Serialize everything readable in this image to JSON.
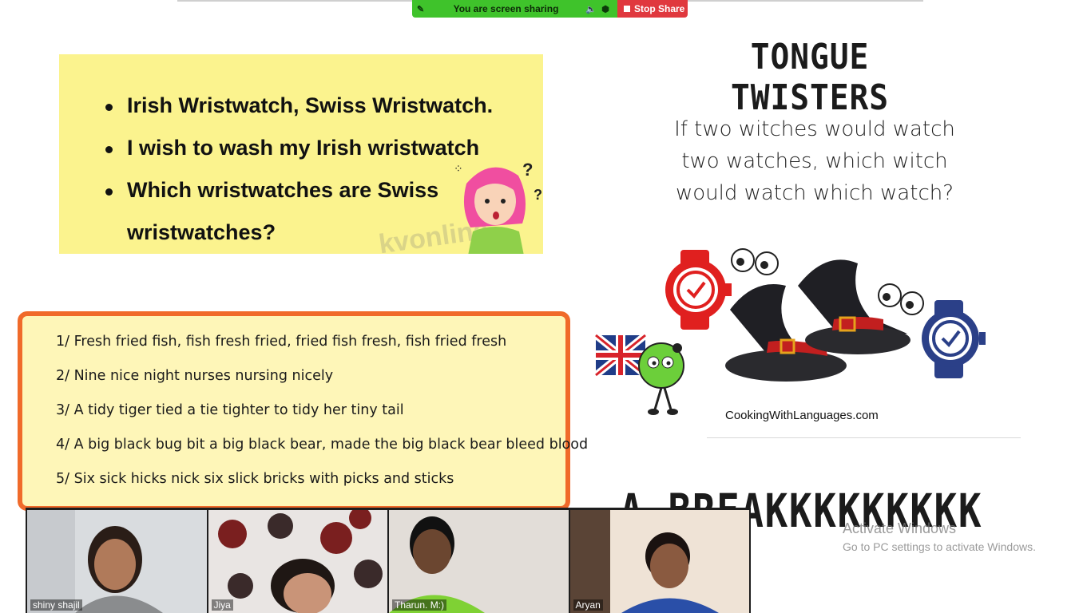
{
  "share_bar": {
    "message": "You are screen sharing",
    "stop_label": "Stop Share",
    "pin_icon": "pin-icon",
    "volume_icon": "speaker-icon",
    "shield_icon": "shield-icon"
  },
  "yellow_slide": {
    "bullets": [
      "Irish Wristwatch, Swiss Wristwatch.",
      "I wish to wash my Irish wristwatch",
      "Which wristwatches are Swiss",
      "wristwatches?"
    ],
    "watermark": "kvonline"
  },
  "orange_slide": {
    "lines": [
      "1/ Fresh fried fish, fish fresh fried, fried fish fresh, fish fried fresh",
      "2/ Nine nice night nurses nursing nicely",
      "3/ A tidy tiger tied a tie tighter to tidy her tiny tail",
      "4/ A big black bug bit a big black bear, made the big black bear bleed blood",
      "5/ Six sick hicks nick six slick bricks with picks and sticks"
    ]
  },
  "right_slide": {
    "title": "TONGUE TWISTERS",
    "poem": [
      "If two witches would watch",
      "two watches, which witch",
      "would watch which watch?"
    ],
    "site": "CookingWithLanguages.com",
    "break_text": "A BREAKKKKKKKKK"
  },
  "activate": {
    "title": "Activate Windows",
    "subtitle": "Go to PC settings to activate Windows."
  },
  "participants": [
    {
      "name": "shiny shajil"
    },
    {
      "name": "Jiya"
    },
    {
      "name": "Tharun. M:)"
    },
    {
      "name": "Aryan"
    }
  ],
  "colors": {
    "share_green": "#3fc32b",
    "stop_red": "#e0383e",
    "orange_border": "#f06a2a",
    "yellow_bg": "#fbf38e"
  }
}
